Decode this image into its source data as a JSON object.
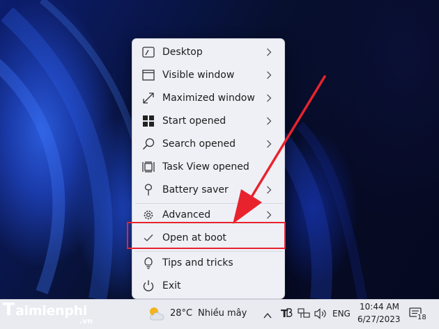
{
  "menu": {
    "items": [
      {
        "label": "Desktop",
        "icon": "desktop-icon",
        "submenu": true
      },
      {
        "label": "Visible window",
        "icon": "window-icon",
        "submenu": true
      },
      {
        "label": "Maximized window",
        "icon": "maximize-icon",
        "submenu": true
      },
      {
        "label": "Start opened",
        "icon": "windows-start-icon",
        "submenu": true
      },
      {
        "label": "Search opened",
        "icon": "search-icon",
        "submenu": true
      },
      {
        "label": "Task View opened",
        "icon": "task-view-icon",
        "submenu": false
      },
      {
        "label": "Battery saver",
        "icon": "battery-saver-icon",
        "submenu": true
      },
      {
        "label": "Advanced",
        "icon": "gear-icon",
        "submenu": true
      },
      {
        "label": "Open at boot",
        "icon": "checkmark-icon",
        "checked": true,
        "submenu": false
      },
      {
        "label": "Tips and tricks",
        "icon": "lightbulb-icon",
        "submenu": false
      },
      {
        "label": "Exit",
        "icon": "power-icon",
        "submenu": false
      }
    ]
  },
  "taskbar": {
    "weather_temp": "28°C",
    "weather_text": "Nhiều mây",
    "language": "ENG",
    "time": "10:44 AM",
    "date": "6/27/2023",
    "notification_count": "18"
  },
  "watermark": {
    "brand_initial": "T",
    "brand_rest": "aimienphi",
    "tld": ".vn"
  },
  "colors": {
    "highlight": "#e8232d",
    "arrow": "#e8232d",
    "menu_bg": "#eef0f6",
    "taskbar_bg": "#e9ebf1"
  }
}
